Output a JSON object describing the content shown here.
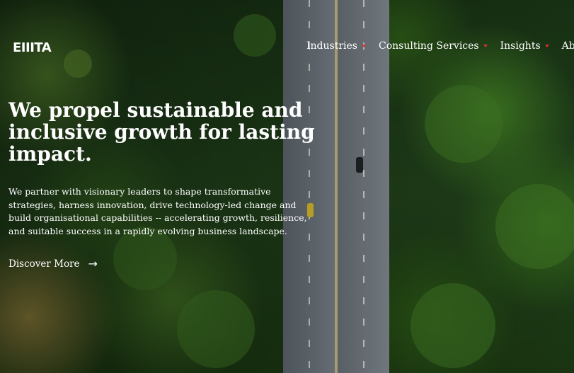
{
  "brand": {
    "logo_text": "EIIITA"
  },
  "nav": {
    "items": [
      {
        "label": "Industries"
      },
      {
        "label": "Consulting Services"
      },
      {
        "label": "Insights"
      },
      {
        "label": "Abou"
      }
    ]
  },
  "hero": {
    "headline": "We propel sustainable and inclusive growth for lasting impact.",
    "body": "We partner with visionary leaders to shape transformative strategies, harness innovation, drive technology-led change and build organisational capabilities -- accelerating growth, resilience, and suitable success in a rapidly evolving business landscape.",
    "cta_label": "Discover More",
    "cta_icon": "arrow-right-icon"
  },
  "colors": {
    "accent": "#e0302a",
    "text": "#ffffff"
  }
}
